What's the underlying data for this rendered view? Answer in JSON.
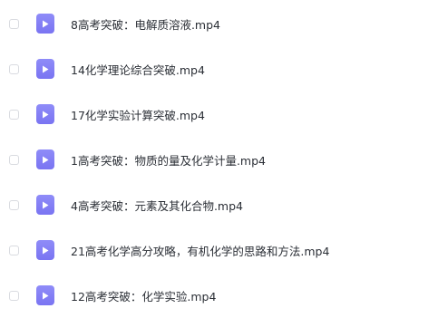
{
  "file_list": {
    "icon": "video-file-icon",
    "icon_color": "#7f7af5",
    "items": [
      {
        "name": "8高考突破：电解质溶液.mp4",
        "checked": false
      },
      {
        "name": "14化学理论综合突破.mp4",
        "checked": false
      },
      {
        "name": "17化学实验计算突破.mp4",
        "checked": false
      },
      {
        "name": "1高考突破：物质的量及化学计量.mp4",
        "checked": false
      },
      {
        "name": "4高考突破：元素及其化合物.mp4",
        "checked": false
      },
      {
        "name": "21高考化学高分攻略，有机化学的思路和方法.mp4",
        "checked": false
      },
      {
        "name": "12高考突破：化学实验.mp4",
        "checked": false
      }
    ]
  }
}
